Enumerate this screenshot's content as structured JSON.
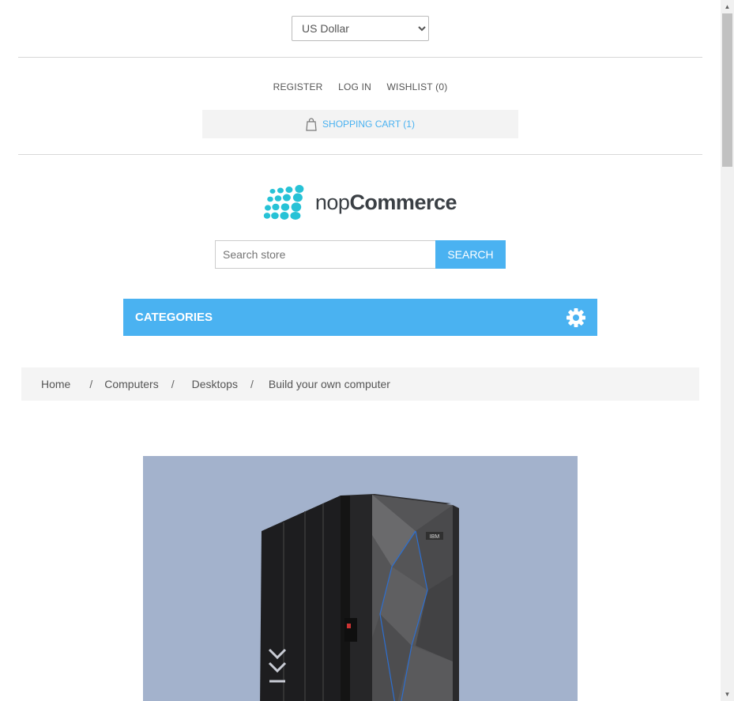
{
  "currency": {
    "selected": "US Dollar"
  },
  "header": {
    "links": {
      "register": "REGISTER",
      "login": "LOG IN",
      "wishlist": "WISHLIST (0)"
    },
    "cart": "SHOPPING CART (1)"
  },
  "logo": {
    "light": "nop",
    "bold": "Commerce"
  },
  "search": {
    "placeholder": "Search store",
    "button": "SEARCH"
  },
  "menu": {
    "categories": "CATEGORIES"
  },
  "breadcrumb": {
    "items": [
      "Home",
      "Computers",
      "Desktops",
      "Build your own computer"
    ],
    "separator": "/"
  },
  "product": {
    "brand_badge": "IBM"
  },
  "colors": {
    "accent": "#4ab2f1",
    "logo_dots": "#27c2d6",
    "image_bg": "#a3b2cc"
  },
  "icons": [
    "shopping-bag-icon",
    "gear-icon",
    "chevron-down-icon"
  ]
}
